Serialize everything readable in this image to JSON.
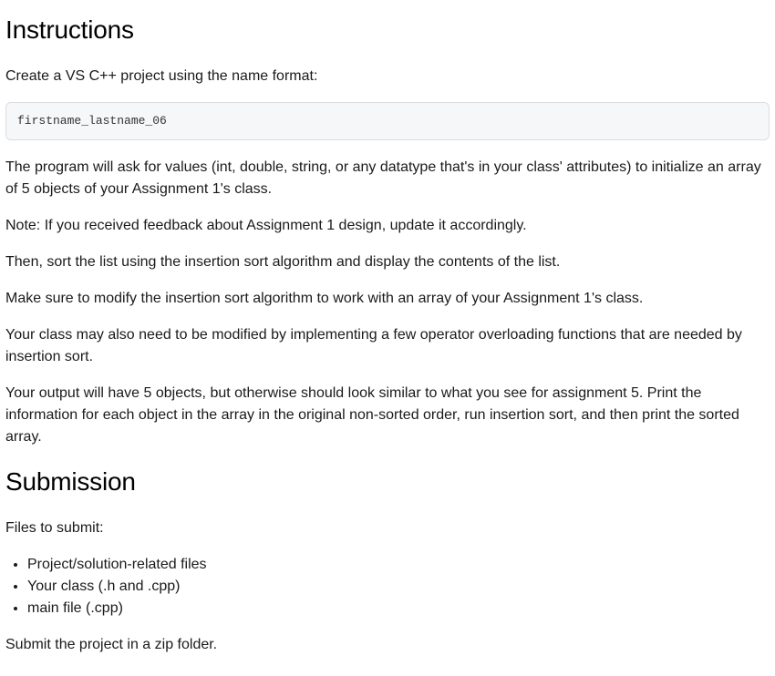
{
  "headings": {
    "instructions": "Instructions",
    "submission": "Submission"
  },
  "paragraphs": {
    "p1": "Create a VS C++ project using the name format:",
    "code1": "firstname_lastname_06",
    "p2": "The program will ask for values (int, double, string, or any datatype that's in your class' attributes) to initialize an array of 5 objects of your Assignment 1's class.",
    "p3": "Note: If you received feedback about Assignment 1 design, update it accordingly.",
    "p4": "Then, sort the list using the insertion sort algorithm and display the contents of the list.",
    "p5": "Make sure to modify the insertion sort algorithm to work with an array of your Assignment 1's class.",
    "p6": "Your class may also need to be modified by implementing a few operator overloading functions that are needed by insertion sort.",
    "p7": "Your output will have 5 objects, but otherwise should look similar to what you see for assignment 5. Print the information for each object in the array in the original non-sorted order, run insertion sort, and then print the sorted array.",
    "p8": "Files to submit:",
    "p9": "Submit the project in a zip folder."
  },
  "submit_list": [
    "Project/solution-related files",
    "Your class (.h and .cpp)",
    "main file (.cpp)"
  ]
}
